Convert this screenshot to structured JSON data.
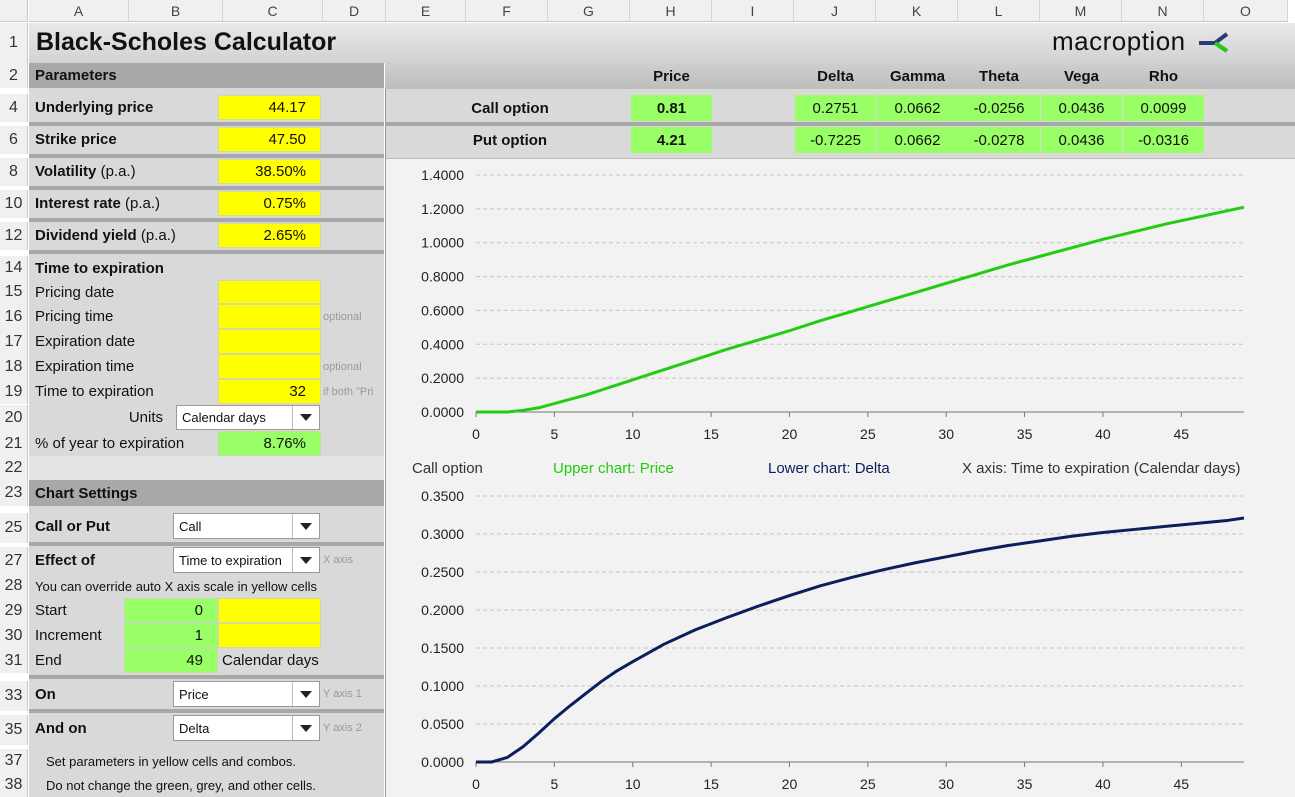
{
  "columns": [
    "A",
    "B",
    "C",
    "D",
    "E",
    "F",
    "G",
    "H",
    "I",
    "J",
    "K",
    "L",
    "M",
    "N",
    "O"
  ],
  "rows": [
    "1",
    "2",
    "4",
    "6",
    "8",
    "10",
    "12",
    "14",
    "15",
    "16",
    "17",
    "18",
    "19",
    "20",
    "21",
    "22",
    "23",
    "25",
    "27",
    "28",
    "29",
    "30",
    "31",
    "33",
    "35",
    "37",
    "38"
  ],
  "title": "Black-Scholes Calculator",
  "logo": "macroption",
  "parameters": {
    "header": "Parameters",
    "underlying_label": "Underlying price",
    "underlying_value": "44.17",
    "strike_label": "Strike price",
    "strike_value": "47.50",
    "vol_label": "Volatility",
    "vol_suffix": "(p.a.)",
    "vol_value": "38.50%",
    "rate_label": "Interest rate",
    "rate_suffix": "(p.a.)",
    "rate_value": "0.75%",
    "div_label": "Dividend yield",
    "div_suffix": "(p.a.)",
    "div_value": "2.65%"
  },
  "time": {
    "header": "Time to expiration",
    "pricing_date": "Pricing date",
    "pricing_time": "Pricing time",
    "expiration_date": "Expiration date",
    "expiration_time": "Expiration time",
    "optional": "optional",
    "tte_label": "Time to expiration",
    "tte_value": "32",
    "tte_note": "if both \"Pri",
    "units_label": "Units",
    "units_value": "Calendar days",
    "pct_label": "% of year to expiration",
    "pct_value": "8.76%"
  },
  "chart_settings": {
    "header": "Chart Settings",
    "callput_label": "Call or Put",
    "callput_value": "Call",
    "effect_label": "Effect of",
    "effect_value": "Time to expiration",
    "xaxis_note": "X axis",
    "override_note": "You can override auto X axis scale in yellow cells",
    "start_label": "Start",
    "start_value": "0",
    "inc_label": "Increment",
    "inc_value": "1",
    "end_label": "End",
    "end_value": "49",
    "end_unit": "Calendar days",
    "on_label": "On",
    "on_value": "Price",
    "y1_note": "Y axis 1",
    "andon_label": "And on",
    "andon_value": "Delta",
    "y2_note": "Y axis 2",
    "help1": "Set parameters in yellow cells and combos.",
    "help2": "Do not change the green, grey, and other cells."
  },
  "results": {
    "headers": {
      "price": "Price",
      "delta": "Delta",
      "gamma": "Gamma",
      "theta": "Theta",
      "vega": "Vega",
      "rho": "Rho"
    },
    "call": {
      "label": "Call option",
      "price": "0.81",
      "delta": "0.2751",
      "gamma": "0.0662",
      "theta": "-0.0256",
      "vega": "0.0436",
      "rho": "0.0099"
    },
    "put": {
      "label": "Put option",
      "price": "4.21",
      "delta": "-0.7225",
      "gamma": "0.0662",
      "theta": "-0.0278",
      "vega": "0.0436",
      "rho": "-0.0316"
    }
  },
  "legend": {
    "option": "Call option",
    "upper": "Upper chart: Price",
    "lower": "Lower chart: Delta",
    "xaxis": "X axis: Time to expiration (Calendar days)"
  },
  "colors": {
    "upper_line": "#22cc11",
    "lower_line": "#0a1f5c",
    "yellow": "#ffff00",
    "green": "#99ff66"
  },
  "chart_data": [
    {
      "type": "line",
      "title": "",
      "xlim": [
        0,
        49
      ],
      "ylim": [
        0,
        1.4
      ],
      "x_ticks": [
        0,
        5,
        10,
        15,
        20,
        25,
        30,
        35,
        40,
        45
      ],
      "y_ticks": [
        "0.0000",
        "0.2000",
        "0.4000",
        "0.6000",
        "0.8000",
        "1.0000",
        "1.2000",
        "1.4000"
      ],
      "series": [
        {
          "x": [
            0,
            1,
            2,
            3,
            4,
            5,
            6,
            7,
            8,
            9,
            10,
            12,
            14,
            16,
            18,
            20,
            22,
            24,
            26,
            28,
            30,
            32,
            34,
            36,
            38,
            40,
            42,
            44,
            46,
            48,
            49
          ],
          "values": [
            0,
            0,
            0,
            0.01,
            0.025,
            0.05,
            0.075,
            0.1,
            0.13,
            0.16,
            0.19,
            0.25,
            0.31,
            0.37,
            0.425,
            0.48,
            0.54,
            0.595,
            0.65,
            0.705,
            0.76,
            0.815,
            0.87,
            0.92,
            0.97,
            1.02,
            1.065,
            1.11,
            1.15,
            1.19,
            1.21
          ]
        }
      ]
    },
    {
      "type": "line",
      "title": "",
      "xlim": [
        0,
        49
      ],
      "ylim": [
        0,
        0.35
      ],
      "x_ticks": [
        0,
        5,
        10,
        15,
        20,
        25,
        30,
        35,
        40,
        45
      ],
      "y_ticks": [
        "0.0000",
        "0.0500",
        "0.1000",
        "0.1500",
        "0.2000",
        "0.2500",
        "0.3000",
        "0.3500"
      ],
      "series": [
        {
          "x": [
            0,
            1,
            2,
            3,
            4,
            5,
            6,
            7,
            8,
            9,
            10,
            12,
            14,
            16,
            18,
            20,
            22,
            24,
            26,
            28,
            30,
            32,
            34,
            36,
            38,
            40,
            42,
            44,
            46,
            48,
            49
          ],
          "values": [
            0,
            0,
            0.006,
            0.02,
            0.038,
            0.057,
            0.074,
            0.09,
            0.106,
            0.12,
            0.132,
            0.155,
            0.174,
            0.19,
            0.205,
            0.219,
            0.232,
            0.243,
            0.253,
            0.262,
            0.27,
            0.278,
            0.285,
            0.291,
            0.297,
            0.302,
            0.306,
            0.31,
            0.314,
            0.318,
            0.321
          ]
        }
      ]
    }
  ]
}
